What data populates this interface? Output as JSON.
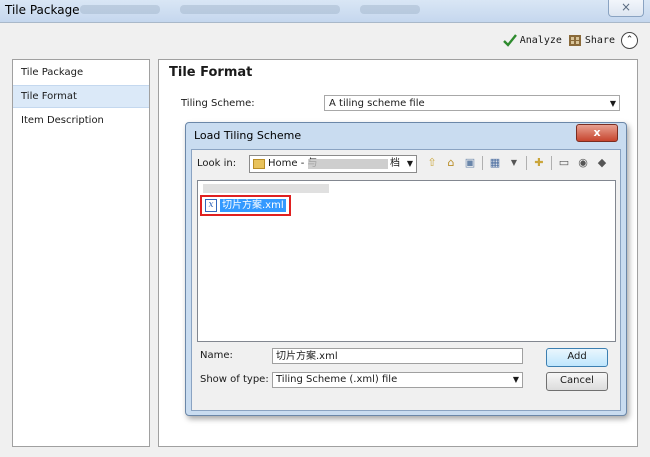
{
  "window": {
    "title": "Tile Package",
    "close_glyph": "×"
  },
  "toolbar": {
    "analyze_label": "Analyze",
    "share_label": "Share",
    "collapse_glyph": "⌃"
  },
  "nav": {
    "items": [
      {
        "label": "Tile Package"
      },
      {
        "label": "Tile Format"
      },
      {
        "label": "Item Description"
      }
    ]
  },
  "main": {
    "section_title": "Tile Format",
    "tiling_scheme_label": "Tiling Scheme:",
    "tiling_scheme_value": "A tiling scheme file"
  },
  "dialog": {
    "title": "Load Tiling Scheme",
    "close_glyph": "x",
    "look_in_label": "Look in:",
    "look_in_value": "Home - 与",
    "look_in_suffix": "档",
    "files": [
      {
        "name": "切片方案.xml",
        "icon": "xml-file-icon"
      }
    ],
    "name_label": "Name:",
    "name_value": "切片方案.xml",
    "type_label": "Show of type:",
    "type_value": "Tiling Scheme (.xml) file",
    "add_label": "Add",
    "cancel_label": "Cancel"
  },
  "icons": {
    "analyze": "check-icon",
    "share": "package-icon",
    "up": "up-folder-icon",
    "home": "home-icon",
    "connect": "connect-folder-icon",
    "view": "view-menu-icon",
    "newfolder": "new-folder-icon",
    "delete": "delete-icon",
    "refresh": "refresh-icon",
    "catalog": "catalog-icon"
  }
}
